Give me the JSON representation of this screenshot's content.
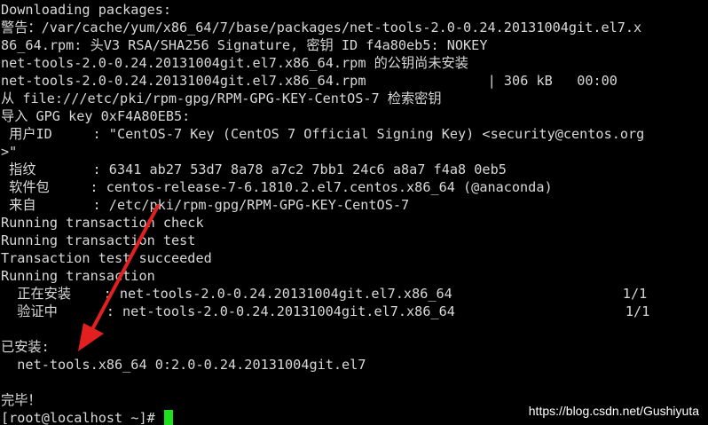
{
  "terminal": {
    "lines": [
      "Downloading packages:",
      "警告：/var/cache/yum/x86_64/7/base/packages/net-tools-2.0-0.24.20131004git.el7.x",
      "86_64.rpm: 头V3 RSA/SHA256 Signature, 密钥 ID f4a80eb5: NOKEY",
      "net-tools-2.0-0.24.20131004git.el7.x86_64.rpm 的公钥尚未安装",
      "net-tools-2.0-0.24.20131004git.el7.x86_64.rpm               | 306 kB   00:00",
      "从 file:///etc/pki/rpm-gpg/RPM-GPG-KEY-CentOS-7 检索密钥",
      "导入 GPG key 0xF4A80EB5:",
      " 用户ID     : \"CentOS-7 Key (CentOS 7 Official Signing Key) <security@centos.org",
      ">\"",
      " 指纹       : 6341 ab27 53d7 8a78 a7c2 7bb1 24c6 a8a7 f4a8 0eb5",
      " 软件包     : centos-release-7-6.1810.2.el7.centos.x86_64 (@anaconda)",
      " 来自       : /etc/pki/rpm-gpg/RPM-GPG-KEY-CentOS-7",
      "Running transaction check",
      "Running transaction test",
      "Transaction test succeeded",
      "Running transaction",
      "  正在安装    : net-tools-2.0-0.24.20131004git.el7.x86_64                     1/1",
      "  验证中      : net-tools-2.0-0.24.20131004git.el7.x86_64                     1/1",
      "",
      "已安装:",
      "  net-tools.x86_64 0:2.0-0.24.20131004git.el7",
      "",
      "完毕！"
    ],
    "prompt": "[root@localhost ~]# "
  },
  "watermark": "https://blog.csdn.net/Gushiyuta",
  "colors": {
    "background": "#000000",
    "text": "#d8d8d8",
    "cursor": "#1fe01f",
    "arrow": "#e32020",
    "watermark": "#ffffff"
  }
}
